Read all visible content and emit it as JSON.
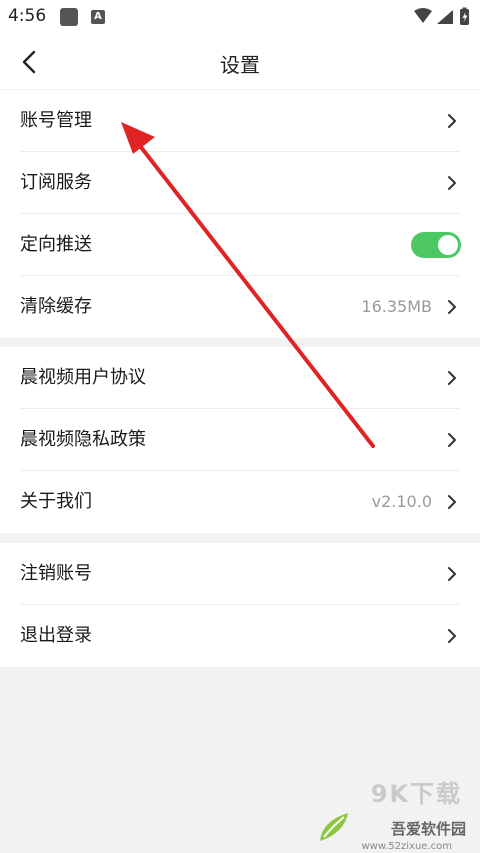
{
  "status_bar": {
    "time": "4:56",
    "app_badge": "A"
  },
  "header": {
    "title": "设置"
  },
  "group1": [
    {
      "label": "账号管理"
    },
    {
      "label": "订阅服务"
    },
    {
      "label": "定向推送",
      "toggle_on": true
    },
    {
      "label": "清除缓存",
      "value": "16.35MB"
    }
  ],
  "group2": [
    {
      "label": "晨视频用户协议"
    },
    {
      "label": "晨视频隐私政策"
    },
    {
      "label": "关于我们",
      "value": "v2.10.0"
    }
  ],
  "group3": [
    {
      "label": "注销账号"
    },
    {
      "label": "退出登录"
    }
  ],
  "watermark": {
    "brand_cn": "吾爱软件园",
    "url": "www.52zixue.com",
    "overlay": "9K下载"
  },
  "colors": {
    "toggle_on": "#4cc764",
    "annotation_arrow": "#e02424"
  }
}
